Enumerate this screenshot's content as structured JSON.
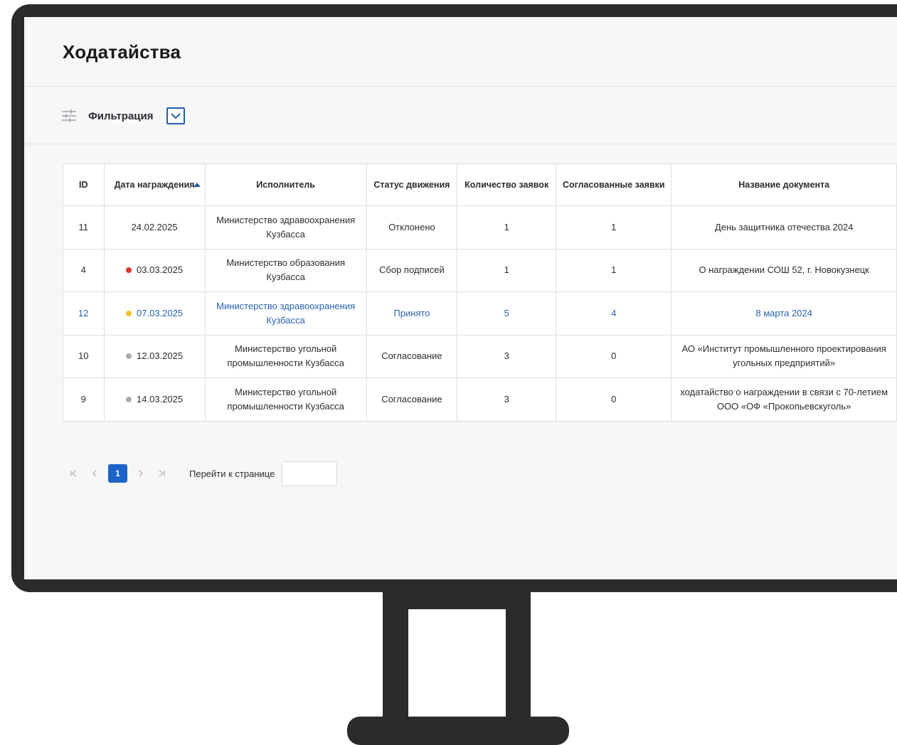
{
  "page": {
    "title": "Ходатайства"
  },
  "filter": {
    "label": "Фильтрация"
  },
  "table": {
    "headers": {
      "id": "ID",
      "date": "Дата награждения",
      "executor": "Исполнитель",
      "status": "Статус движения",
      "count": "Количество заявок",
      "approved": "Согласованные заявки",
      "doc_name": "Название документа"
    },
    "rows": [
      {
        "id": "11",
        "date": "24.02.2025",
        "dot": "",
        "executor": "Министерство здравоохранения Кузбасса",
        "status": "Отклонено",
        "count": "1",
        "approved": "1",
        "doc_name": "День защитника отечества 2024"
      },
      {
        "id": "4",
        "date": "03.03.2025",
        "dot": "#e0342f",
        "executor": "Министерство образования Кузбасса",
        "status": "Сбор подписей",
        "count": "1",
        "approved": "1",
        "doc_name": "О награждении СОШ 52, г. Новокузнецк"
      },
      {
        "id": "12",
        "date": "07.03.2025",
        "dot": "#f3bf34",
        "executor": "Министерство здравоохранения Кузбасса",
        "status": "Принято",
        "count": "5",
        "approved": "4",
        "doc_name": "8 марта 2024"
      },
      {
        "id": "10",
        "date": "12.03.2025",
        "dot": "#a9adb3",
        "executor": "Министерство угольной промышленности Кузбасса",
        "status": "Согласование",
        "count": "3",
        "approved": "0",
        "doc_name": "АО «Институт промышленного проектирования угольных предприятий»"
      },
      {
        "id": "9",
        "date": "14.03.2025",
        "dot": "#a9adb3",
        "executor": "Министерство угольной промышленности Кузбасса",
        "status": "Согласование",
        "count": "3",
        "approved": "0",
        "doc_name": "ходатайство о награждении в связи с 70-летием ООО «ОФ «Прокопьевскуголь»"
      }
    ]
  },
  "pagination": {
    "first_icon": "first-page-icon",
    "prev_icon": "prev-page-icon",
    "current_page": "1",
    "next_icon": "next-page-icon",
    "last_icon": "last-page-icon",
    "goto_label": "Перейти к странице",
    "goto_value": ""
  },
  "colors": {
    "accent": "#1e63c6",
    "link": "#2a63b0",
    "dot_red": "#e0342f",
    "dot_yellow": "#f3bf34",
    "dot_gray": "#a9adb3",
    "monitor_frame": "#2b2b2b"
  }
}
